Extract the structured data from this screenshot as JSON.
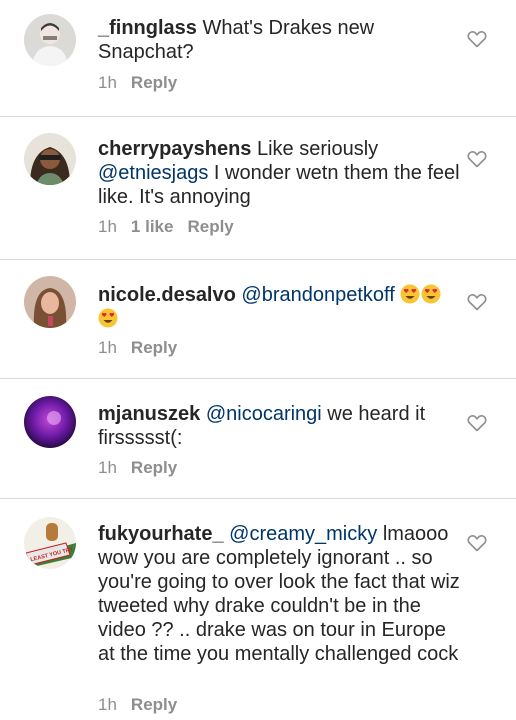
{
  "comments": [
    {
      "username": "_finnglass",
      "text": " What's Drakes new Snapchat?",
      "time": "1h",
      "likes": "",
      "reply": "Reply"
    },
    {
      "username": "cherrypayshens",
      "text_pre": " Like seriously ",
      "mention": "@etniesjags",
      "text_post": " I wonder wetn them the feel like. It's annoying",
      "time": "1h",
      "likes": "1 like",
      "reply": "Reply"
    },
    {
      "username": "nicole.desalvo",
      "text_pre": " ",
      "mention": "@brandonpetkoff",
      "text_post": " ",
      "emojis": [
        "heart-eyes-emoji",
        "heart-eyes-emoji",
        "heart-eyes-emoji"
      ],
      "time": "1h",
      "likes": "",
      "reply": "Reply"
    },
    {
      "username": "mjanuszek",
      "text_pre": " ",
      "mention": "@nicocaringi",
      "text_post": " we heard it firssssst(:",
      "time": "1h",
      "likes": "",
      "reply": "Reply"
    },
    {
      "username": "fukyourhate_",
      "text_pre": " ",
      "mention": "@creamy_micky",
      "text_post": " lmaooo wow you are completely ignorant .. so you're going to over look the fact that wiz tweeted why drake couldn't be in the video ?? .. drake was on tour in Europe at the time you mentally challenged cock",
      "avatar_text": "AT LEAST YOU TRY",
      "time": "1h",
      "likes": "",
      "reply": "Reply"
    }
  ],
  "colors": {
    "mention": "#003569",
    "meta": "#8e8e8e",
    "divider": "#dbdbdb",
    "heart": "#8e8e8e"
  },
  "icons": {
    "like": "heart-outline-icon"
  }
}
